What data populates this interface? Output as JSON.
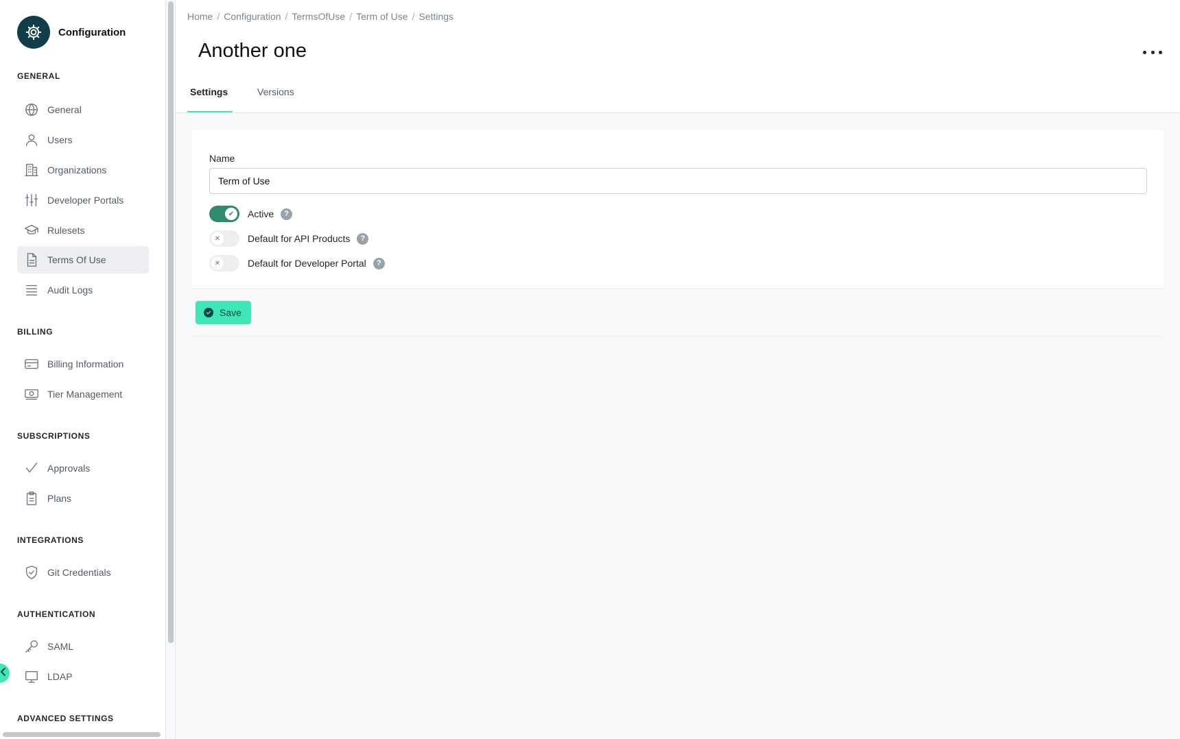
{
  "sidebar": {
    "brand_title": "Configuration",
    "sections": {
      "general": "GENERAL",
      "billing": "BILLING",
      "subscriptions": "SUBSCRIPTIONS",
      "integrations": "INTEGRATIONS",
      "authentication": "AUTHENTICATION",
      "advanced": "ADVANCED SETTINGS"
    },
    "items": {
      "general": {
        "label": "General",
        "icon": "globe-icon"
      },
      "users": {
        "label": "Users",
        "icon": "user-icon"
      },
      "organizations": {
        "label": "Organizations",
        "icon": "building-icon"
      },
      "developer_portals": {
        "label": "Developer Portals",
        "icon": "sliders-icon"
      },
      "rulesets": {
        "label": "Rulesets",
        "icon": "graduation-cap-icon"
      },
      "terms_of_use": {
        "label": "Terms Of Use",
        "icon": "document-icon",
        "active": true
      },
      "audit_logs": {
        "label": "Audit Logs",
        "icon": "list-icon"
      },
      "billing_information": {
        "label": "Billing Information",
        "icon": "credit-card-icon"
      },
      "tier_management": {
        "label": "Tier Management",
        "icon": "money-icon"
      },
      "approvals": {
        "label": "Approvals",
        "icon": "check-icon"
      },
      "plans": {
        "label": "Plans",
        "icon": "clipboard-icon"
      },
      "git_credentials": {
        "label": "Git Credentials",
        "icon": "shield-check-icon"
      },
      "saml": {
        "label": "SAML",
        "icon": "key-icon"
      },
      "ldap": {
        "label": "LDAP",
        "icon": "monitor-icon"
      }
    }
  },
  "breadcrumb": [
    "Home",
    "Configuration",
    "TermsOfUse",
    "Term of Use",
    "Settings"
  ],
  "page": {
    "title": "Another one",
    "tabs": {
      "settings": "Settings",
      "versions": "Versions"
    },
    "active_tab": "Settings"
  },
  "form": {
    "name_label": "Name",
    "name_value": "Term of Use",
    "toggles": {
      "active": {
        "label": "Active",
        "on": true
      },
      "default_api_products": {
        "label": "Default for API Products",
        "on": false
      },
      "default_dev_portal": {
        "label": "Default for Developer Portal",
        "on": false
      }
    },
    "help_glyph": "?",
    "save_label": "Save"
  },
  "colors": {
    "accent": "#3ee7b5",
    "toggle_on": "#2e8b6e",
    "brand_dark": "#0f3d48"
  }
}
